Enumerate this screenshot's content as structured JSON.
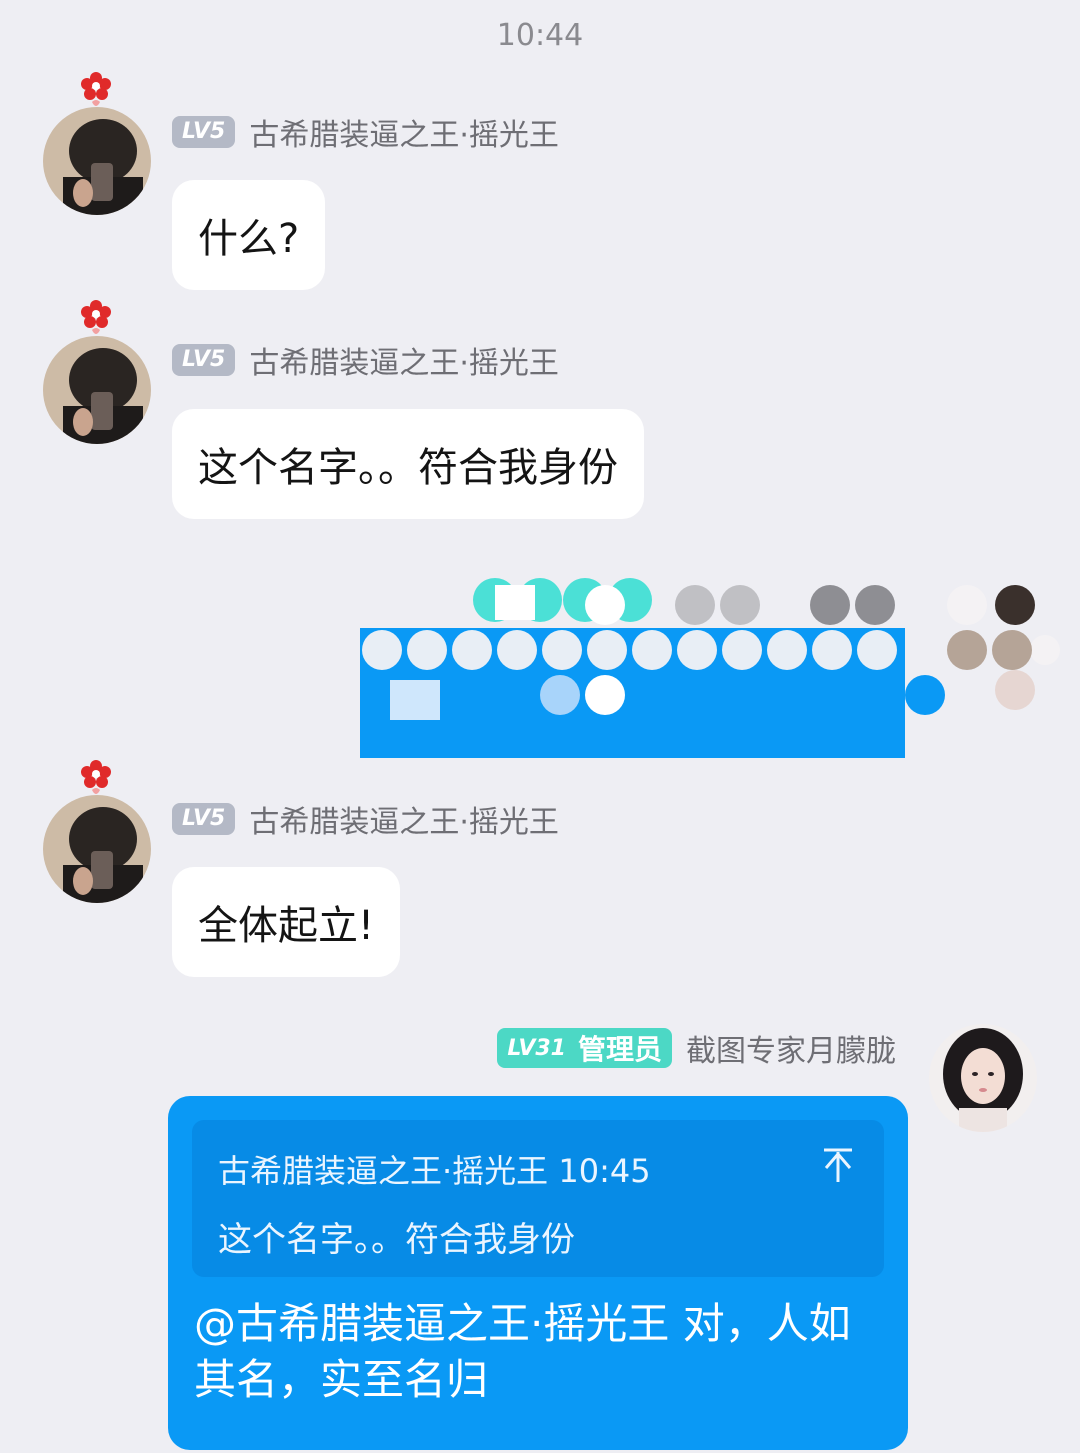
{
  "status_time": "10:44",
  "messages": [
    {
      "level": "LV5",
      "sender": "古希腊装逼之王·摇光王",
      "text": "什么?"
    },
    {
      "level": "LV5",
      "sender": "古希腊装逼之王·摇光王",
      "text": "这个名字。。符合我身份"
    },
    {
      "level": "LV5",
      "sender": "古希腊装逼之王·摇光王",
      "text": "全体起立!"
    }
  ],
  "self_message": {
    "level": "LV31",
    "role": "管理员",
    "sender": "截图专家月朦胧",
    "quote_header": "古希腊装逼之王·摇光王 10:45",
    "quote_text": "这个名字。。符合我身份",
    "text": "@古希腊装逼之王·摇光王 对，人如其名，实至名归"
  },
  "colors": {
    "background": "#EEEEF3",
    "self_bubble": "#0A99F5",
    "quote_box": "#078BE6",
    "admin_badge": "#4CD8C5",
    "level_badge": "#B4B9C6"
  }
}
